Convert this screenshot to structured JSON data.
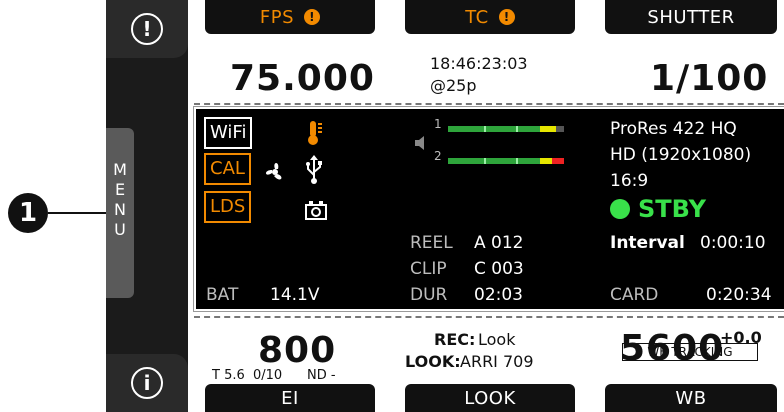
{
  "callout": "1",
  "side": {
    "top_icon": "!",
    "bottom_icon": "i",
    "menu_letters": [
      "M",
      "E",
      "N",
      "U"
    ]
  },
  "top": {
    "fps_label": "FPS",
    "fps_value": "75.000",
    "tc_label": "TC",
    "tc_value": "18:46:23:03",
    "tc_rate": "@25p",
    "shutter_label": "SHUTTER",
    "shutter_value": "1/100"
  },
  "panel": {
    "wifi": "WiFi",
    "cal": "CAL",
    "lds": "LDS",
    "temp_icon": "thermometer-icon",
    "fan_icon": "fan-icon",
    "usb_icon": "usb-icon",
    "camera_icon": "camera-icon",
    "speaker_icon": "speaker-icon",
    "ch1": "1",
    "ch2": "2",
    "codec": "ProRes 422 HQ",
    "resolution": "HD (1920x1080)",
    "aspect": "16:9",
    "status": "STBY",
    "interval_label": "Interval",
    "interval_value": "0:00:10",
    "reel_label": "REEL",
    "reel_value": "A 012",
    "clip_label": "CLIP",
    "clip_value": "C 003",
    "dur_label": "DUR",
    "dur_value": "02:03",
    "bat_label": "BAT",
    "bat_value": "14.1V",
    "card_label": "CARD",
    "card_value": "0:20:34"
  },
  "bottom": {
    "ei_value": "800",
    "ei_detail": "T 5.6  0/10      ND -",
    "ei_label": "EI",
    "rec_label": "REC:",
    "rec_value": "Look",
    "look_label": "LOOK:",
    "look_value": "ARRI 709",
    "look_button": "LOOK",
    "wb_value": "5600",
    "wb_tint": "+0.0",
    "wb_tracking": "WB TRACKING",
    "wb_label": "WB"
  },
  "colors": {
    "warning": "#f28a00",
    "stby": "#39e14a",
    "meter": "#2ea43b"
  }
}
